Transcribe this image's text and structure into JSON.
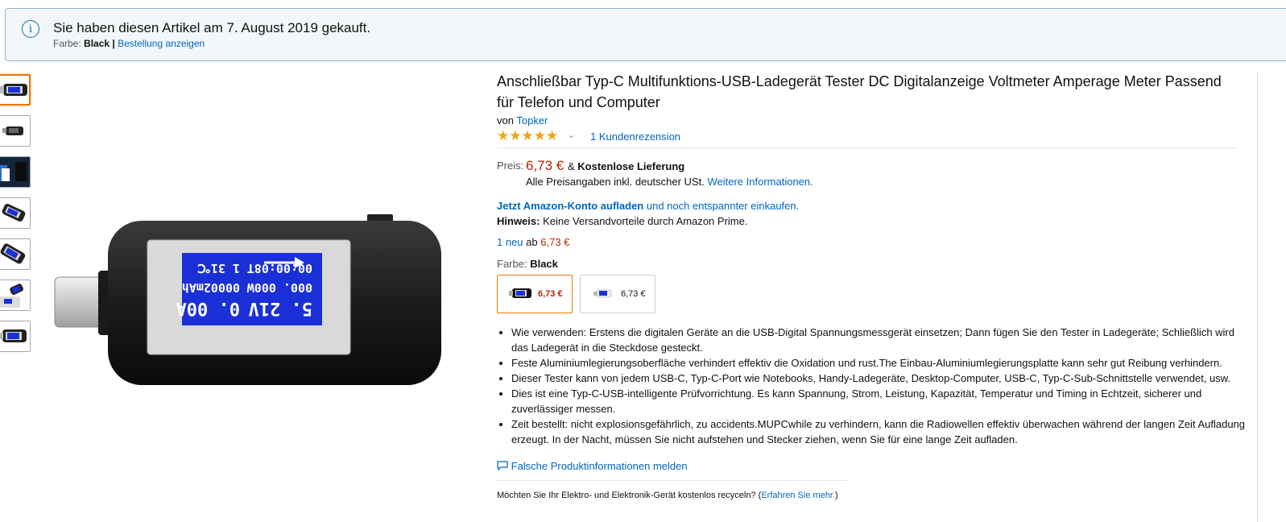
{
  "notice": {
    "icon": "info-icon",
    "title": "Sie haben diesen Artikel am 7. August 2019 gekauft.",
    "color_label": "Farbe:",
    "color_value": "Black",
    "separator": "|",
    "order_link": "Bestellung anzeigen"
  },
  "product": {
    "title": "Anschließbar Typ-C Multifunktions-USB-Ladegerät Tester DC Digitalanzeige Voltmeter Amperage Meter Passend für Telefon und Computer",
    "by_label": "von",
    "brand": "Topker",
    "stars": "★★★★★",
    "rating_chevron": "⌄",
    "reviews_link": "1 Kundenrezension",
    "rating_value": 5,
    "price_label": "Preis:",
    "price": "6,73 €",
    "amp": "&",
    "shipping": "Kostenlose Lieferung",
    "tax_note": "Alle Preisangaben inkl. deutscher USt.",
    "tax_link": "Weitere Informationen.",
    "promo_link": "Jetzt Amazon-Konto aufladen",
    "promo_rest": "und noch entspannter einkaufen.",
    "hint_label": "Hinweis:",
    "hint_text": "Keine Versandvorteile durch Amazon Prime.",
    "offers_link": "1 neu",
    "offers_from": "ab",
    "offers_price": "6,73 €",
    "color_label": "Farbe:",
    "color_value": "Black",
    "swatches": [
      {
        "price": "6,73 €",
        "selected": true
      },
      {
        "price": "6,73 €",
        "selected": false
      }
    ],
    "bullets": [
      "Wie verwenden: Erstens die digitalen Geräte an die USB-Digital Spannungsmessgerät einsetzen; Dann fügen Sie den Tester in Ladegeräte; Schließlich wird das Ladegerät in die Steckdose gesteckt.",
      "Feste Aluminiumlegierungsoberfläche verhindert effektiv die Oxidation und rust.The Einbau-Aluminiumlegierungsplatte kann sehr gut Reibung verhindern.",
      "Dieser Tester kann von jedem USB-C, Typ-C-Port wie Notebooks, Handy-Ladegeräte, Desktop-Computer, USB-C, Typ-C-Sub-Schnittstelle verwendet, usw.",
      "Dies ist eine Typ-C-USB-intelligente Prüfvorrichtung. Es kann Spannung, Strom, Leistung, Kapazität, Temperatur und Timing in Echtzeit, sicherer und zuverlässiger messen.",
      "Zeit bestellt: nicht explosionsgefährlich, zu accidents.MUPCwhile zu verhindern, kann die Radiowellen effektiv überwachen während der langen Zeit Aufladung erzeugt. In der Nacht, müssen Sie nicht aufstehen und Stecker ziehen, wenn Sie für eine lange Zeit aufladen."
    ],
    "report_link": "Falsche Produktinformationen melden",
    "recycle_text": "Möchten Sie Ihr Elektro- und Elektronik-Gerät kostenlos recyceln? (",
    "recycle_link": "Erfahren Sie mehr.",
    "recycle_close": ")"
  },
  "device_screen": {
    "line1_a": "5. 21V",
    "line1_b": "0. 00A",
    "line2_a": "000. 000W",
    "line2_b": "00002mAh",
    "line3_a": "00:00:08T",
    "line3_b": "1  31℃"
  },
  "colors": {
    "accent_orange": "#e77600",
    "price_red": "#b12704",
    "link_blue": "#0066c0",
    "star_orange": "#f2a311",
    "screen_blue": "#1b2fd6"
  }
}
